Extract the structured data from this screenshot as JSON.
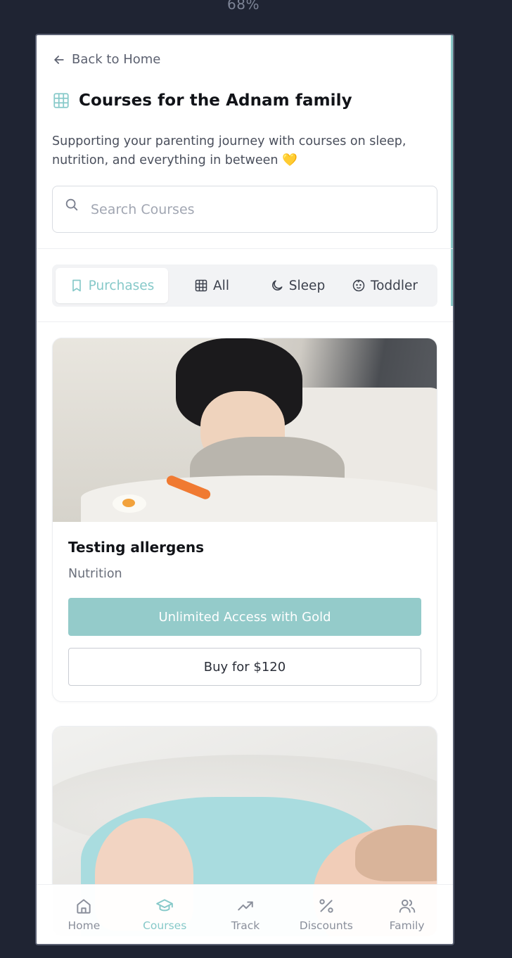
{
  "top_indicator": "68%",
  "back_link": "Back to Home",
  "page_title": "Courses for the Adnam family",
  "subtitle": "Supporting your parenting journey with courses on sleep, nutrition, and everything in between",
  "subtitle_emoji": "💛",
  "search": {
    "placeholder": "Search Courses",
    "value": ""
  },
  "tabs": [
    {
      "label": "Purchases",
      "icon": "bookmark-icon",
      "active": true
    },
    {
      "label": "All",
      "icon": "grid-icon",
      "active": false
    },
    {
      "label": "Sleep",
      "icon": "moon-icon",
      "active": false
    },
    {
      "label": "Toddler",
      "icon": "baby-face-icon",
      "active": false
    }
  ],
  "courses": [
    {
      "image": "baby-eating-photo",
      "title": "Testing allergens",
      "category": "Nutrition",
      "gold_button": "Unlimited Access with Gold",
      "buy_button": "Buy for $120"
    },
    {
      "image": "baby-sleeping-photo"
    }
  ],
  "bottom_nav": [
    {
      "label": "Home",
      "icon": "home-icon",
      "active": false
    },
    {
      "label": "Courses",
      "icon": "graduation-cap-icon",
      "active": true
    },
    {
      "label": "Track",
      "icon": "trending-up-icon",
      "active": false
    },
    {
      "label": "Discounts",
      "icon": "percent-icon",
      "active": false
    },
    {
      "label": "Family",
      "icon": "users-icon",
      "active": false
    }
  ],
  "colors": {
    "accent": "#86c9c9",
    "gold_button": "#94cbca",
    "background": "#1f2433"
  }
}
